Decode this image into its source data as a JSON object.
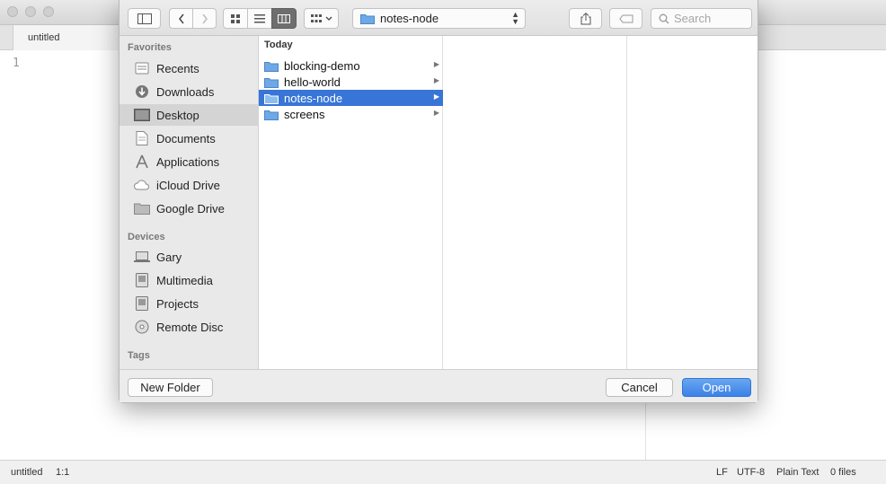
{
  "editor": {
    "tab_title": "untitled",
    "line_number": "1"
  },
  "status_bar": {
    "filename": "untitled",
    "cursor": "1:1",
    "line_ending": "LF",
    "encoding": "UTF-8",
    "grammar": "Plain Text",
    "files": "0 files"
  },
  "dialog": {
    "toolbar": {
      "path": "notes-node",
      "search_placeholder": "Search"
    },
    "sidebar": {
      "favorites_heading": "Favorites",
      "favorites": [
        {
          "label": "Recents",
          "icon": "clock-icon"
        },
        {
          "label": "Downloads",
          "icon": "download-icon"
        },
        {
          "label": "Desktop",
          "icon": "desktop-icon",
          "selected": true
        },
        {
          "label": "Documents",
          "icon": "document-icon"
        },
        {
          "label": "Applications",
          "icon": "applications-icon"
        },
        {
          "label": "iCloud Drive",
          "icon": "cloud-icon"
        },
        {
          "label": "Google Drive",
          "icon": "folder-icon"
        }
      ],
      "devices_heading": "Devices",
      "devices": [
        {
          "label": "Gary",
          "icon": "laptop-icon"
        },
        {
          "label": "Multimedia",
          "icon": "drive-icon"
        },
        {
          "label": "Projects",
          "icon": "drive-icon"
        },
        {
          "label": "Remote Disc",
          "icon": "disc-icon"
        }
      ],
      "tags_heading": "Tags"
    },
    "column1": {
      "heading": "Today",
      "items": [
        {
          "label": "blocking-demo"
        },
        {
          "label": "hello-world"
        },
        {
          "label": "notes-node",
          "selected": true
        },
        {
          "label": "screens"
        }
      ]
    },
    "footer": {
      "new_folder": "New Folder",
      "cancel": "Cancel",
      "open": "Open"
    },
    "colors": {
      "selection": "#3875d7",
      "primary_button": "#3a82e8",
      "folder": "#6fa8e6"
    }
  }
}
